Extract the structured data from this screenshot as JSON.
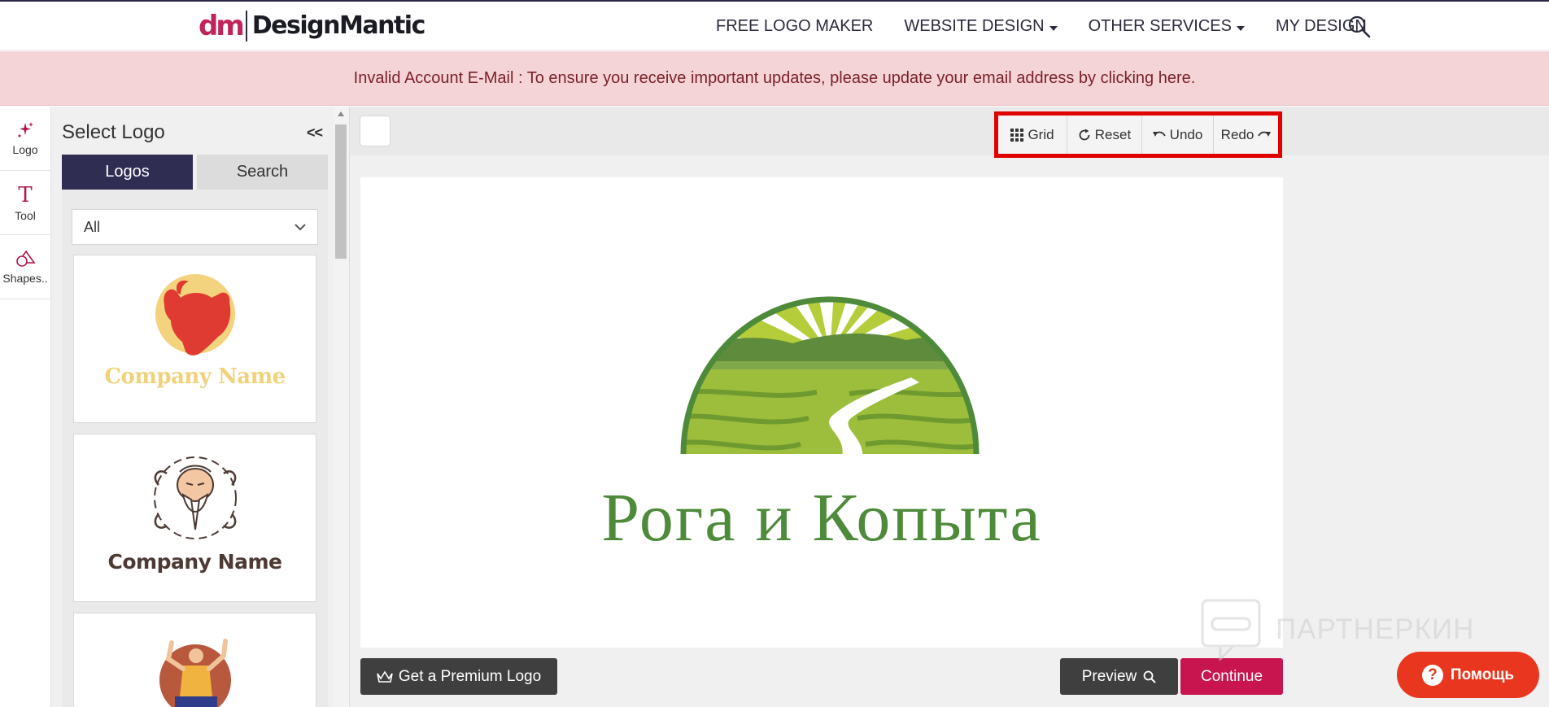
{
  "header": {
    "brand_mark": "dm",
    "brand_name": "DesignMantic",
    "nav": [
      {
        "label": "FREE LOGO MAKER",
        "dropdown": false
      },
      {
        "label": "WEBSITE DESIGN",
        "dropdown": true
      },
      {
        "label": "OTHER SERVICES",
        "dropdown": true
      },
      {
        "label": "MY DESIGN",
        "dropdown": false
      }
    ],
    "search_icon": "search-icon"
  },
  "alert": {
    "text": "Invalid Account E-Mail : To ensure you receive important updates, please update your email address by clicking here."
  },
  "rail": {
    "items": [
      {
        "label": "Logo",
        "icon": "sparkle-icon"
      },
      {
        "label": "Tool",
        "icon": "text-t-icon"
      },
      {
        "label": "Shapes..",
        "icon": "shapes-icon"
      }
    ]
  },
  "panel": {
    "title": "Select Logo",
    "collapse_label": "<<",
    "tabs": {
      "logos": "Logos",
      "search": "Search"
    },
    "filter_value": "All",
    "cards": [
      {
        "company_text": "Company Name",
        "emblem": "bull-icon"
      },
      {
        "company_text": "Company Name",
        "emblem": "sage-icon"
      },
      {
        "company_text": "",
        "emblem": "kungfu-figure-icon"
      }
    ]
  },
  "toolbar": {
    "grid": "Grid",
    "reset": "Reset",
    "undo": "Undo",
    "redo": "Redo"
  },
  "canvas": {
    "logo_text": "Рога и Копыта",
    "logo_color": "#4e8a3a"
  },
  "actions": {
    "premium": "Get a Premium Logo",
    "preview": "Preview",
    "continue": "Continue"
  },
  "watermark": {
    "text": "ПАРТНЕРКИН"
  },
  "help": {
    "label": "Помощь"
  },
  "colors": {
    "accent": "#c8144f",
    "nav_dark": "#2f2d52",
    "alert_bg": "#f5d4d8",
    "highlight": "#e00000",
    "help": "#e8371e"
  }
}
